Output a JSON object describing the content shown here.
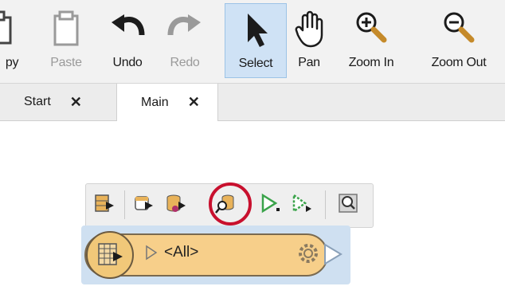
{
  "toolbar": {
    "buttons": [
      {
        "label": "py",
        "icon": "copy-icon",
        "enabled": true
      },
      {
        "label": "Paste",
        "icon": "clipboard-icon",
        "enabled": false
      },
      {
        "label": "Undo",
        "icon": "undo-icon",
        "enabled": true
      },
      {
        "label": "Redo",
        "icon": "redo-icon",
        "enabled": false
      },
      {
        "label": "Select",
        "icon": "cursor-arrow-icon",
        "enabled": true,
        "active": true
      },
      {
        "label": "Pan",
        "icon": "hand-icon",
        "enabled": true
      },
      {
        "label": "Zoom In",
        "icon": "zoom-in-icon",
        "enabled": true
      },
      {
        "label": "Zoom Out",
        "icon": "zoom-out-icon",
        "enabled": true
      }
    ]
  },
  "tabs": [
    {
      "label": "Start",
      "close": "✕",
      "active": false
    },
    {
      "label": "Main",
      "close": "✕",
      "active": true
    }
  ],
  "node_toolbar": {
    "buttons": [
      {
        "icon": "run-to-this-icon"
      },
      {
        "icon": "feature-type-run-icon"
      },
      {
        "icon": "database-run-icon"
      },
      {
        "icon": "inspect-cached-features-icon",
        "highlighted": true
      },
      {
        "icon": "run-from-this-icon"
      },
      {
        "icon": "run-partial-icon"
      },
      {
        "icon": "zoom-to-node-icon"
      }
    ]
  },
  "reader_node": {
    "label": "<All>",
    "icon": "reader-feature-type-icon"
  },
  "colors": {
    "node_fill": "#f7cf8a",
    "selection_bg": "#cfe0f1",
    "highlight_ring": "#c8102e",
    "active_tool_bg": "#cfe2f5"
  }
}
